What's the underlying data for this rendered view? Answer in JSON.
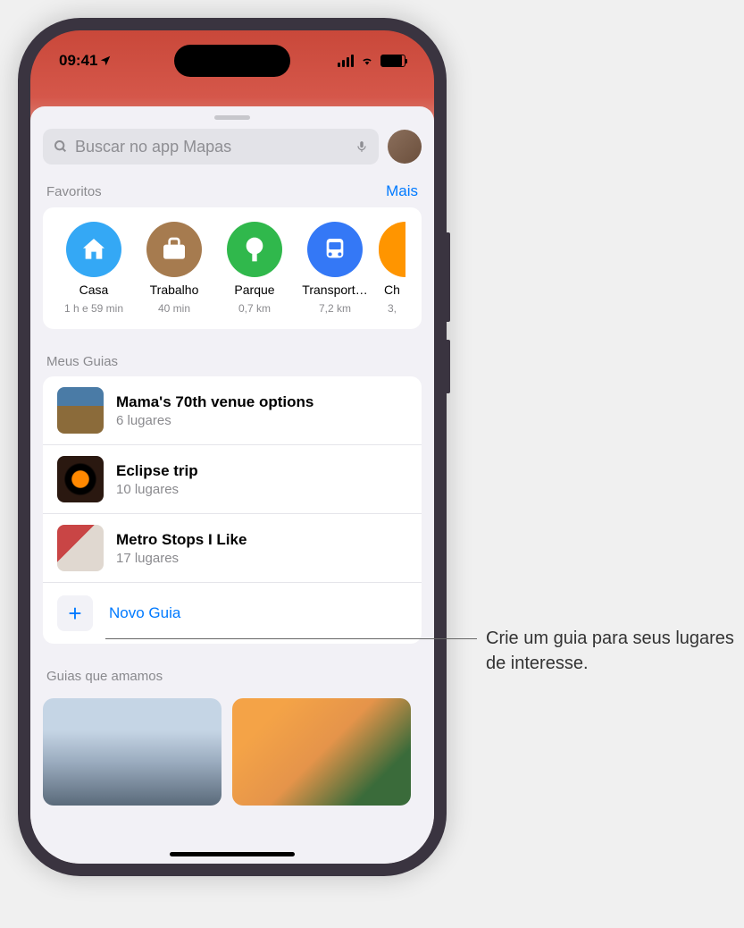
{
  "status": {
    "time": "09:41",
    "location_arrow": "↗"
  },
  "search": {
    "placeholder": "Buscar no app Mapas"
  },
  "favorites": {
    "header": "Favoritos",
    "more": "Mais",
    "items": [
      {
        "label": "Casa",
        "sub": "1 h e 59 min"
      },
      {
        "label": "Trabalho",
        "sub": "40 min"
      },
      {
        "label": "Parque",
        "sub": "0,7 km"
      },
      {
        "label": "Transport…",
        "sub": "7,2 km"
      },
      {
        "label": "Ch",
        "sub": "3,"
      }
    ]
  },
  "my_guides": {
    "header": "Meus Guias",
    "items": [
      {
        "title": "Mama's 70th venue options",
        "sub": "6 lugares"
      },
      {
        "title": "Eclipse trip",
        "sub": "10 lugares"
      },
      {
        "title": "Metro Stops I Like",
        "sub": "17 lugares"
      }
    ],
    "new_guide": "Novo Guia"
  },
  "loved": {
    "header": "Guias que amamos"
  },
  "callout": "Crie um guia para seus lugares de interesse."
}
